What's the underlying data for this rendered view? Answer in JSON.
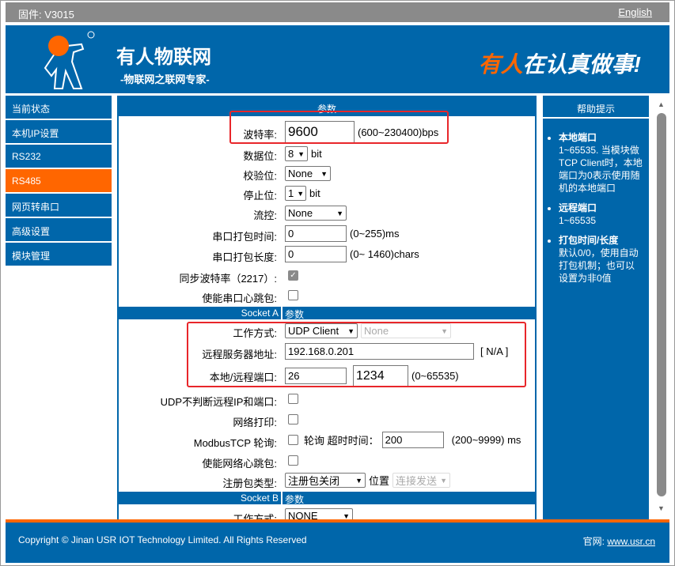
{
  "topbar": {
    "firmware": "固件: V3015",
    "language_link": "English"
  },
  "header": {
    "brand": "有人物联网",
    "slogan": "-物联网之联网专家-",
    "motto_highlight": "有人",
    "motto_rest": "在认真做事!"
  },
  "sidebar": {
    "items": [
      {
        "label": "当前状态"
      },
      {
        "label": "本机IP设置"
      },
      {
        "label": "RS232"
      },
      {
        "label": "RS485",
        "active": true
      },
      {
        "label": "网页转串口"
      },
      {
        "label": "高级设置"
      },
      {
        "label": "模块管理"
      }
    ]
  },
  "main": {
    "header": "参数",
    "serial": {
      "baud_label": "波特率:",
      "baud_value": "9600",
      "baud_range": "(600~230400)bps",
      "data_bits_label": "数据位:",
      "data_bits_value": "8",
      "data_bits_unit": "bit",
      "parity_label": "校验位:",
      "parity_value": "None",
      "stop_bits_label": "停止位:",
      "stop_bits_value": "1",
      "stop_bits_unit": "bit",
      "flow_label": "流控:",
      "flow_value": "None",
      "pack_time_label": "串口打包时间:",
      "pack_time_value": "0",
      "pack_time_range": "(0~255)ms",
      "pack_len_label": "串口打包长度:",
      "pack_len_value": "0",
      "pack_len_range": "(0~ 1460)chars",
      "sync_baud_label": "同步波特率（2217）:",
      "sync_baud_checked": true,
      "heartbeat_label": "使能串口心跳包:",
      "heartbeat_checked": false
    },
    "socket_a": {
      "title": "Socket A",
      "param": "参数",
      "mode_label": "工作方式:",
      "mode_value": "UDP Client",
      "mode_sub_value": "None",
      "remote_label": "远程服务器地址:",
      "remote_value": "192.168.0.201",
      "remote_status": "[ N/A ]",
      "port_label": "本地/远程端口:",
      "local_port": "26",
      "remote_port": "1234",
      "port_range": "(0~65535)",
      "udp_check_label": "UDP不判断远程IP和端口:",
      "net_print_label": "网络打印:",
      "modbus_label": "ModbusTCP 轮询:",
      "modbus_timeout_label": "轮询 超时时间：",
      "modbus_timeout_value": "200",
      "modbus_range": "(200~9999) ms",
      "net_heartbeat_label": "使能网络心跳包:",
      "reg_label": "注册包类型:",
      "reg_value": "注册包关闭",
      "reg_pos_label": "位置",
      "reg_pos_value": "连接发送"
    },
    "socket_b": {
      "title": "Socket B",
      "param": "参数",
      "mode_label": "工作方式:",
      "mode_value": "NONE"
    }
  },
  "help": {
    "title": "帮助提示",
    "items": [
      {
        "title": "本地端口",
        "text": "1~65535. 当模块做TCP Client时，本地端口为0表示使用随机的本地端口"
      },
      {
        "title": "远程端口",
        "text": "1~65535"
      },
      {
        "title": "打包时间/长度",
        "text": "默认0/0，使用自动打包机制；也可以设置为非0值"
      }
    ]
  },
  "footer": {
    "copyright": "Copyright © Jinan USR IOT Technology Limited. All Rights Reserved",
    "site_label": "官网:",
    "site_link": "www.usr.cn"
  },
  "colors": {
    "primary": "#0066aa",
    "accent": "#ff6600",
    "highlight_box": "#e8262a"
  }
}
